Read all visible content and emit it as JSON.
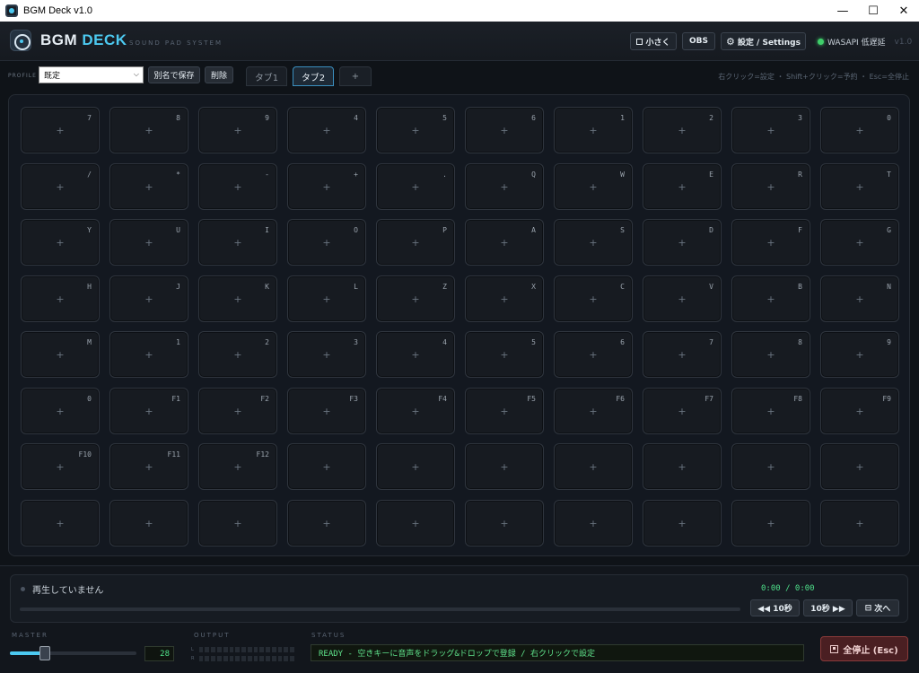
{
  "window": {
    "title": "BGM Deck v1.0",
    "minimize": "—",
    "maximize": "☐",
    "close": "✕"
  },
  "header": {
    "brand_part1": "BGM",
    "brand_part2": "DECK",
    "tagline": "SOUND PAD SYSTEM",
    "compact_label": "小さく",
    "obs_label": "OBS",
    "settings_label": "設定 / Settings",
    "settings_icon": "⚙",
    "audio_status": "WASAPI 低遅延",
    "version": "v1.0",
    "accent_color": "#4cc9f0",
    "status_color": "#3fcf6a"
  },
  "profile": {
    "label": "PROFILE",
    "selected": "既定",
    "save_as_label": "別名で保存",
    "delete_label": "削除"
  },
  "tabs": [
    {
      "label": "タブ1",
      "active": false
    },
    {
      "label": "タブ2",
      "active": true
    },
    {
      "label": "+",
      "active": false
    }
  ],
  "hint": "右クリック=設定 ・ Shift+クリック=予約 ・ Esc=全停止",
  "pads": {
    "empty_symbol": "+",
    "keys": [
      "7",
      "8",
      "9",
      "4",
      "5",
      "6",
      "1",
      "2",
      "3",
      "0",
      "/",
      "*",
      "-",
      "+",
      ".",
      "Q",
      "W",
      "E",
      "R",
      "T",
      "Y",
      "U",
      "I",
      "O",
      "P",
      "A",
      "S",
      "D",
      "F",
      "G",
      "H",
      "J",
      "K",
      "L",
      "Z",
      "X",
      "C",
      "V",
      "B",
      "N",
      "M",
      "1",
      "2",
      "3",
      "4",
      "5",
      "6",
      "7",
      "8",
      "9",
      "0",
      "F1",
      "F2",
      "F3",
      "F4",
      "F5",
      "F6",
      "F7",
      "F8",
      "F9",
      "F10",
      "F11",
      "F12",
      "",
      "",
      "",
      "",
      "",
      "",
      "",
      "",
      "",
      "",
      "",
      "",
      "",
      "",
      "",
      "",
      ""
    ]
  },
  "player": {
    "now_playing": "再生していません",
    "time": "0:00 / 0:00",
    "back_label": "◀◀ 10秒",
    "forward_label": "10秒 ▶▶",
    "next_label": "次へ",
    "progress": 0
  },
  "master": {
    "label": "MASTER",
    "volume": "28",
    "volume_fraction": 0.28
  },
  "output": {
    "label": "OUTPUT",
    "left_channel": "L",
    "right_channel": "R"
  },
  "status": {
    "label": "STATUS",
    "text": "READY - 空きキーに音声をドラッグ&ドロップで登録 / 右クリックで設定"
  },
  "stop_all_label": "全停止 (Esc)"
}
